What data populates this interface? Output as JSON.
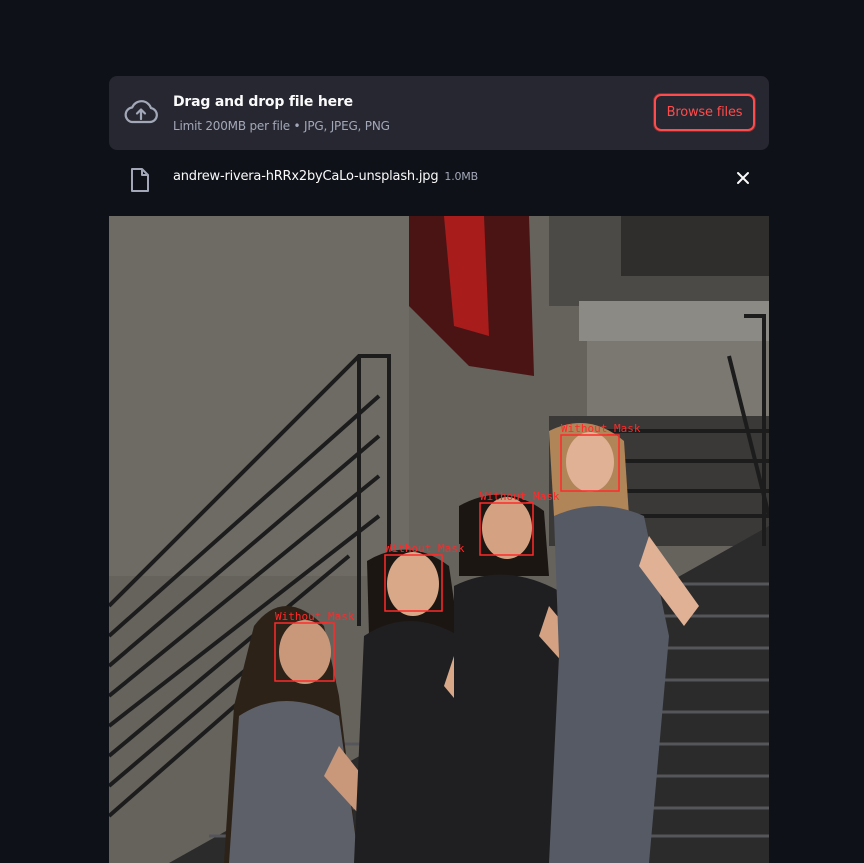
{
  "uploader": {
    "title": "Drag and drop file here",
    "hint": "Limit 200MB per file • JPG, JPEG, PNG",
    "browse_label": "Browse files",
    "icon": "cloud-upload-icon"
  },
  "uploaded_file": {
    "name": "andrew-rivera-hRRx2byCaLo-unsplash.jpg",
    "size": "1.0MB",
    "icon": "file-icon",
    "remove_icon": "close-icon"
  },
  "detections": [
    {
      "label": "Without_Mask"
    },
    {
      "label": "Without_Mask"
    },
    {
      "label": "Without_Mask"
    },
    {
      "label": "Without_Mask"
    }
  ],
  "colors": {
    "background": "#0e1117",
    "dropzone": "#262730",
    "accent": "#ff4b4b",
    "detection_box": "#ff2a2a"
  }
}
